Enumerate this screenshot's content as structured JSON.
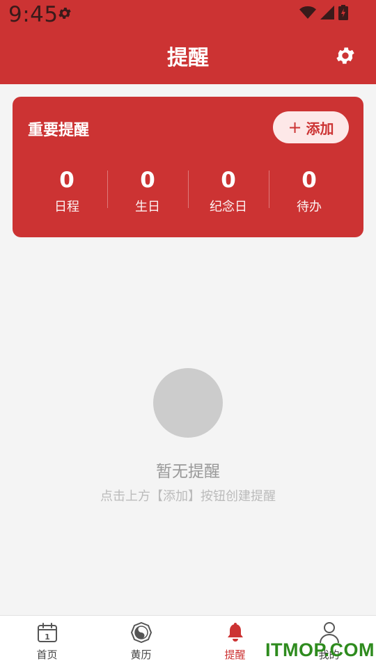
{
  "status_bar": {
    "time": "9:45",
    "icons": [
      "settings-gear-icon",
      "wifi-icon",
      "signal-icon",
      "battery-charging-icon"
    ]
  },
  "header": {
    "title": "提醒",
    "settings_icon": "gear-icon"
  },
  "colors": {
    "primary": "#cc3333",
    "add_button_bg": "#fde8e8",
    "background": "#f4f4f4",
    "placeholder": "#cccccc"
  },
  "card": {
    "title": "重要提醒",
    "add_button": {
      "icon": "plus-icon",
      "label": "添加"
    },
    "stats": [
      {
        "value": "0",
        "label": "日程"
      },
      {
        "value": "0",
        "label": "生日"
      },
      {
        "value": "0",
        "label": "纪念日"
      },
      {
        "value": "0",
        "label": "待办"
      }
    ]
  },
  "empty_state": {
    "title": "暂无提醒",
    "description": "点击上方【添加】按钮创建提醒"
  },
  "bottom_nav": {
    "active_index": 2,
    "items": [
      {
        "label": "首页",
        "icon": "calendar-icon"
      },
      {
        "label": "黄历",
        "icon": "yin-yang-icon"
      },
      {
        "label": "提醒",
        "icon": "bell-icon"
      },
      {
        "label": "我的",
        "icon": "person-icon"
      }
    ]
  },
  "watermark": "ITMOP.COM"
}
